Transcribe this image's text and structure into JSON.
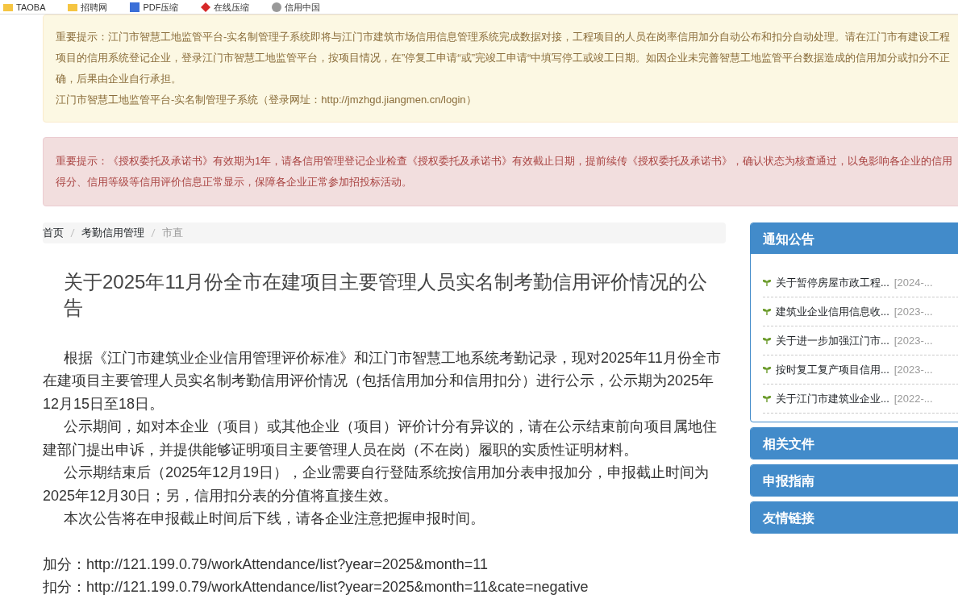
{
  "bookmarks": [
    {
      "label": "TAOBA"
    },
    {
      "label": "招聘网"
    },
    {
      "label": "PDF压缩"
    },
    {
      "label": "在线压缩"
    },
    {
      "label": "信用中国"
    }
  ],
  "alerts": [
    {
      "kind": "warning",
      "lines": [
        "重要提示：江门市智慧工地监管平台-实名制管理子系统即将与江门市建筑市场信用信息管理系统完成数据对接，工程项目的人员在岗率信用加分自动公布和扣分自动处理。请在江门市有建设工程项目的信用系统登记企业，登录江门市智慧工地监管平台，按项目情况，在”停复工申请“或”完竣工申请“中填写停工或竣工日期。如因企业未完善智慧工地监管平台数据造成的信用加分或扣分不正确，后果由企业自行承担。",
        "江门市智慧工地监管平台-实名制管理子系统（登录网址：http://jmzhgd.jiangmen.cn/login）"
      ]
    },
    {
      "kind": "danger",
      "lines": [
        "重要提示：《授权委托及承诺书》有效期为1年，请各信用管理登记企业检查《授权委托及承诺书》有效截止日期，提前续传《授权委托及承诺书》，确认状态为核查通过，以免影响各企业的信用得分、信用等级等信用评价信息正常显示，保障各企业正常参加招投标活动。"
      ]
    }
  ],
  "breadcrumb": [
    {
      "label": "首页",
      "selected": false
    },
    {
      "label": "考勤信用管理",
      "selected": false
    },
    {
      "label": "市直",
      "selected": true
    }
  ],
  "article": {
    "title": "关于2025年11月份全市在建项目主要管理人员实名制考勤信用评价情况的公告",
    "paragraphs": [
      "根据《江门市建筑业企业信用管理评价标准》和江门市智慧工地系统考勤记录，现对2025年11月份全市在建项目主要管理人员实名制考勤信用评价情况（包括信用加分和信用扣分）进行公示，公示期为2025年12月15日至18日。",
      "公示期间，如对本企业（项目）或其他企业（项目）评价计分有异议的，请在公示结束前向项目属地住建部门提出申诉，并提供能够证明项目主要管理人员在岗（不在岗）履职的实质性证明材料。",
      "公示期结束后（2025年12月19日），企业需要自行登陆系统按信用加分表申报加分，申报截止时间为2025年12月30日；另，信用扣分表的分值将直接生效。",
      "本次公告将在申报截止时间后下线，请各企业注意把握申报时间。"
    ],
    "links": [
      "加分：http://121.199.0.79/workAttendance/list?year=2025&month=11",
      "扣分：http://121.199.0.79/workAttendance/list?year=2025&month=11&cate=negative"
    ]
  },
  "sidebar": [
    {
      "title": "通知公告",
      "expanded": true,
      "items": [
        {
          "title": "关于暂停房屋市政工程...",
          "date": "[2024-..."
        },
        {
          "title": "建筑业企业信用信息收...",
          "date": "[2023-..."
        },
        {
          "title": "关于进一步加强江门市...",
          "date": "[2023-..."
        },
        {
          "title": "按时复工复产项目信用...",
          "date": "[2023-..."
        },
        {
          "title": "关于江门市建筑业企业...",
          "date": "[2022-..."
        }
      ]
    },
    {
      "title": "相关文件",
      "expanded": false
    },
    {
      "title": "申报指南",
      "expanded": false
    },
    {
      "title": "友情链接",
      "expanded": false
    }
  ]
}
